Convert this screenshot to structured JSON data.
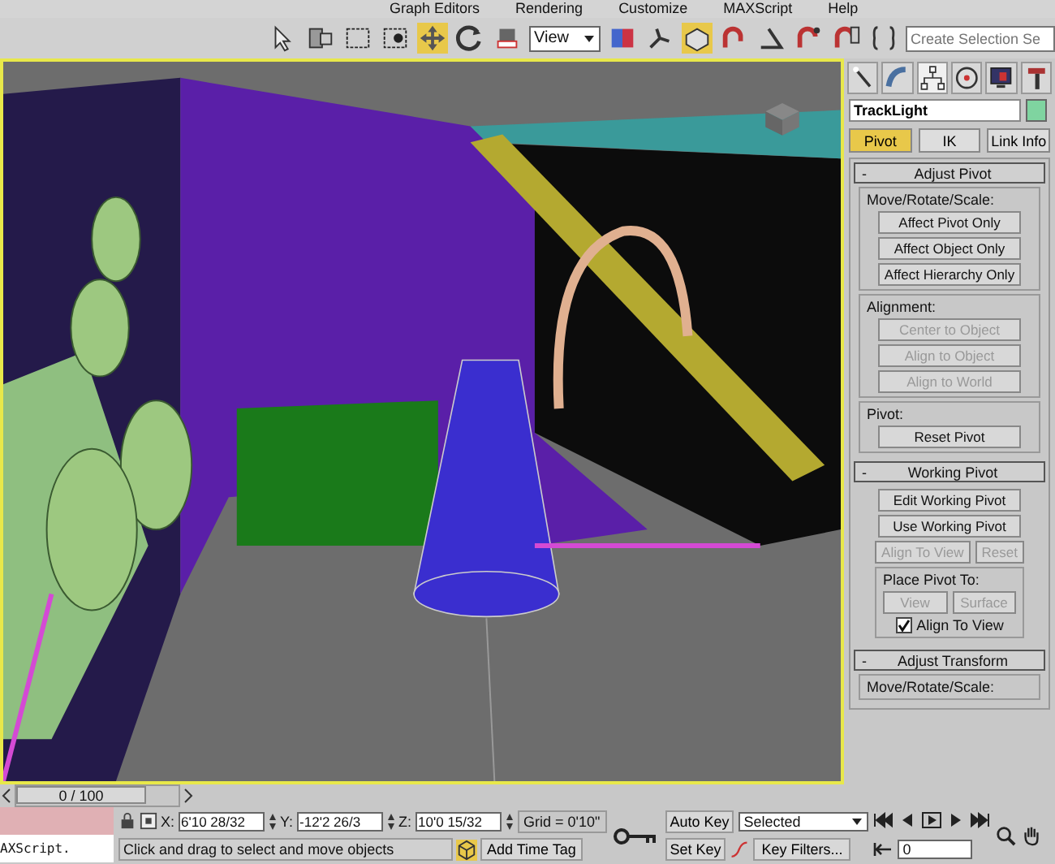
{
  "menu_bar": {
    "items": [
      "Graph Editors",
      "Rendering",
      "Customize",
      "MAXScript",
      "Help"
    ]
  },
  "toolbar": {
    "view_dropdown": "View",
    "selection_set": {
      "placeholder": "Create Selection Se"
    }
  },
  "command_panel": {
    "object": {
      "name": "TrackLight",
      "color": "#7fd4a0"
    },
    "tabs": [
      {
        "label": "Pivot",
        "selected": true
      },
      {
        "label": "IK",
        "selected": false
      },
      {
        "label": "Link Info",
        "selected": false
      }
    ],
    "rollouts": [
      {
        "toggle": "-",
        "title": "Adjust Pivot",
        "groups": [
          {
            "label": "Move/Rotate/Scale:",
            "rows": [
              [
                {
                  "kind": "button",
                  "label": "Affect Pivot Only",
                  "disabled": false
                }
              ],
              [
                {
                  "kind": "button",
                  "label": "Affect Object Only",
                  "disabled": false
                }
              ],
              [
                {
                  "kind": "button",
                  "label": "Affect Hierarchy Only",
                  "disabled": false
                }
              ]
            ]
          },
          {
            "label": "Alignment:",
            "rows": [
              [
                {
                  "kind": "button",
                  "label": "Center to Object",
                  "disabled": true
                }
              ],
              [
                {
                  "kind": "button",
                  "label": "Align to Object",
                  "disabled": true
                }
              ],
              [
                {
                  "kind": "button",
                  "label": "Align to World",
                  "disabled": true
                }
              ]
            ]
          },
          {
            "label": "Pivot:",
            "rows": [
              [
                {
                  "kind": "button",
                  "label": "Reset Pivot",
                  "disabled": false
                }
              ]
            ]
          }
        ]
      },
      {
        "toggle": "-",
        "title": "Working Pivot",
        "groups": [
          {
            "rows": [
              [
                {
                  "kind": "button",
                  "label": "Edit Working Pivot",
                  "disabled": false
                }
              ],
              [
                {
                  "kind": "button",
                  "label": "Use Working Pivot",
                  "disabled": false
                }
              ],
              [
                {
                  "kind": "button",
                  "label": "Align To View",
                  "disabled": true
                },
                {
                  "kind": "button",
                  "label": "Reset",
                  "disabled": true
                }
              ]
            ],
            "subgroup": {
              "label": "Place Pivot To:",
              "rows": [
                [
                  {
                    "kind": "button",
                    "label": "View",
                    "disabled": true
                  },
                  {
                    "kind": "button",
                    "label": "Surface",
                    "disabled": true
                  }
                ],
                [
                  {
                    "kind": "checkbox",
                    "label": "Align To View",
                    "checked": true
                  }
                ]
              ]
            }
          }
        ]
      },
      {
        "toggle": "-",
        "title": "Adjust Transform",
        "groups": [
          {
            "label": "Move/Rotate/Scale:"
          }
        ]
      }
    ]
  },
  "timeline": {
    "position": "0 / 100",
    "level": 0
  },
  "maxscript_listener": {
    "value": "AXScript."
  },
  "status_bar": {
    "prompt": "Click and drag to select and move objects",
    "coordinates": [
      {
        "axis": "X:",
        "value": "6'10 28/32"
      },
      {
        "axis": "Y:",
        "value": "-12'2 26/3"
      },
      {
        "axis": "Z:",
        "value": "10'0 15/32"
      }
    ],
    "grid": "Grid = 0'10\"",
    "add_time_tag": "Add Time Tag",
    "auto_key": "Auto Key",
    "set_key": "Set Key",
    "key_mode": "Selected",
    "key_filters": "Key Filters...",
    "current_frame": "0"
  }
}
